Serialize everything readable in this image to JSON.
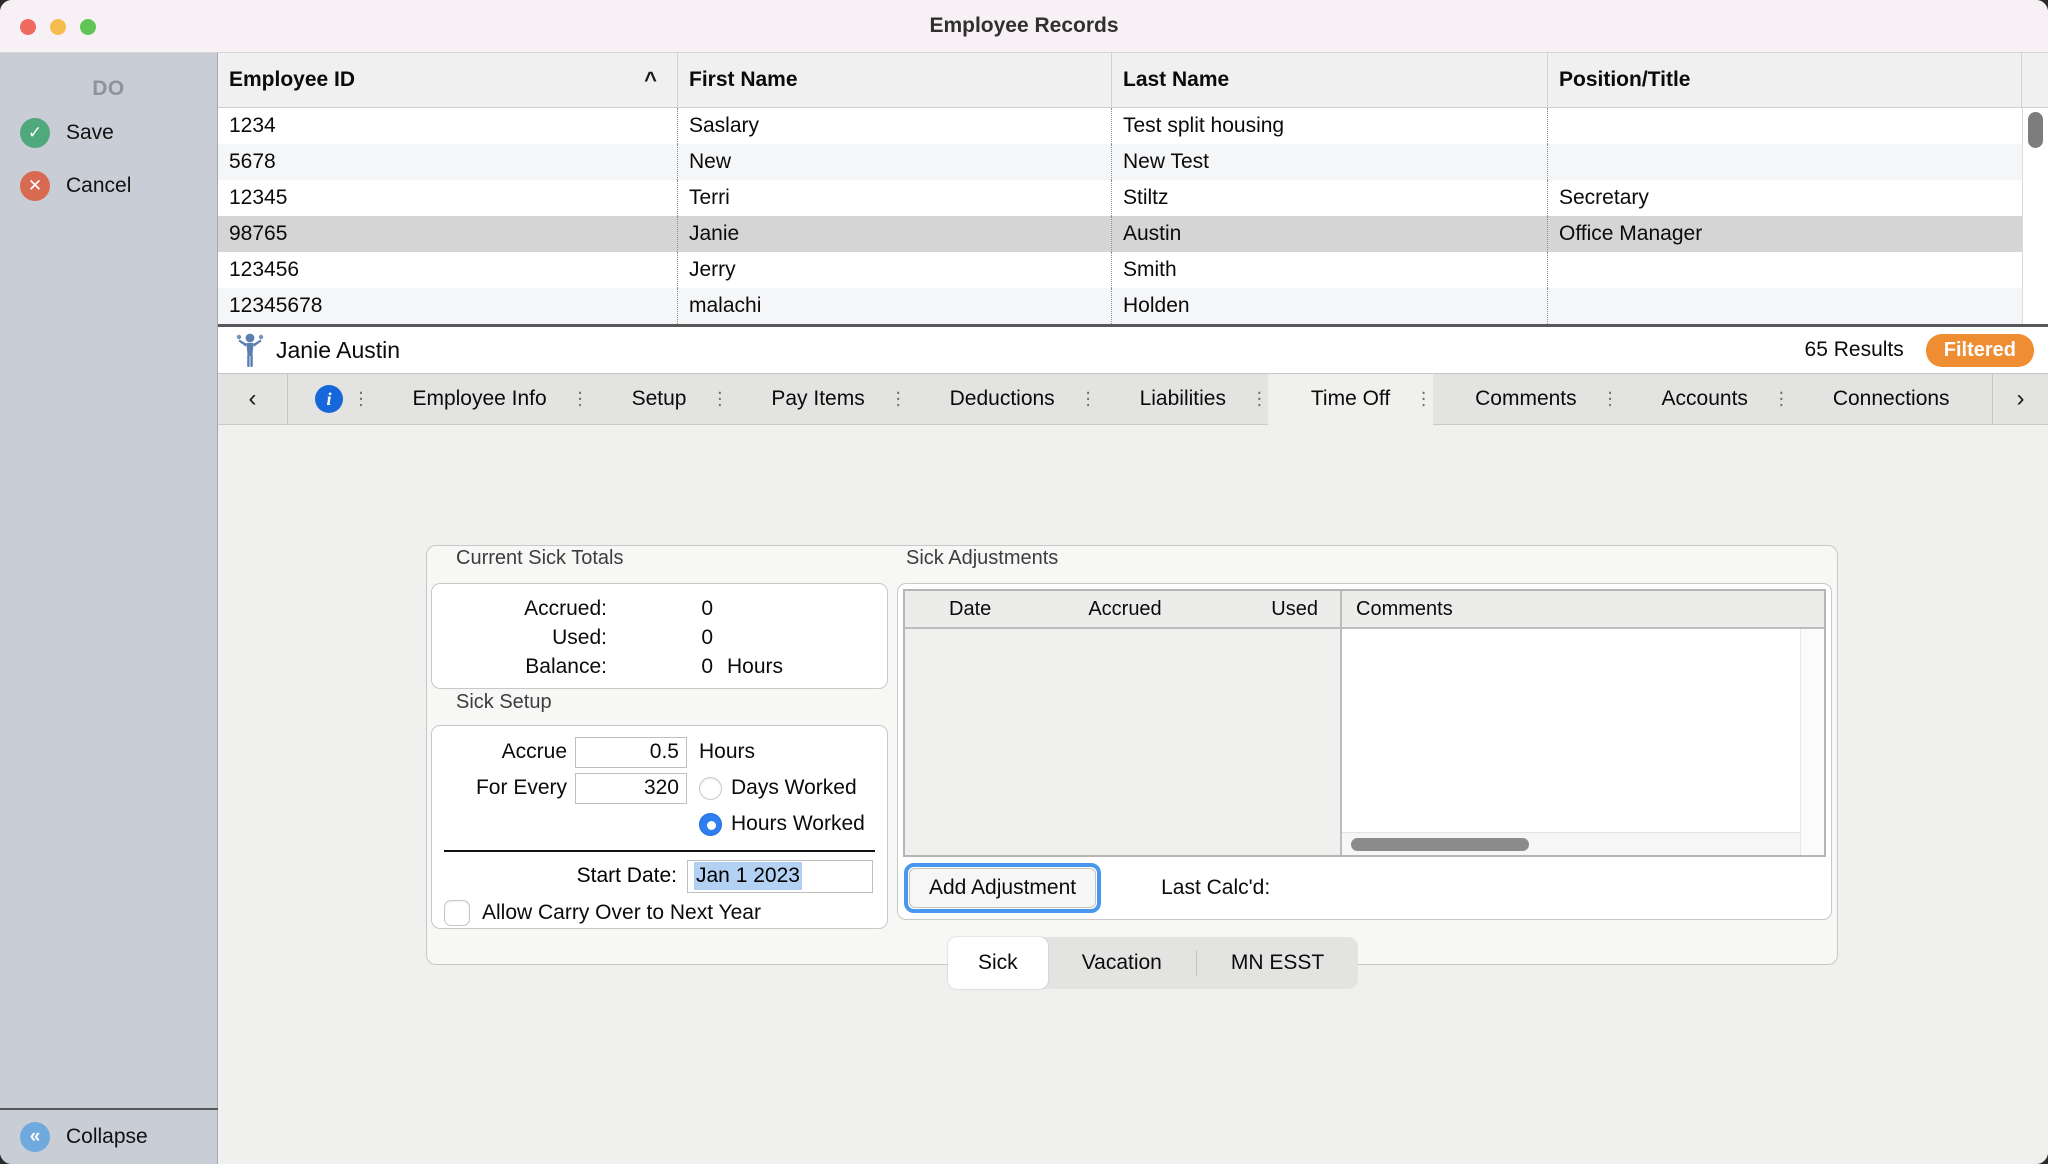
{
  "window": {
    "title": "Employee Records"
  },
  "sidebar": {
    "header": "DO",
    "save_label": "Save",
    "cancel_label": "Cancel",
    "collapse_label": "Collapse",
    "save_icon": "check",
    "cancel_icon": "x",
    "collapse_icon": "double-chevron-left"
  },
  "table": {
    "columns": [
      "Employee ID",
      "First Name",
      "Last Name",
      "Position/Title"
    ],
    "sort_caret": "^",
    "rows": [
      [
        "1234",
        "Saslary",
        "Test split housing",
        ""
      ],
      [
        "5678",
        "New",
        "New Test",
        ""
      ],
      [
        "12345",
        "Terri",
        "Stiltz",
        "Secretary"
      ],
      [
        "98765",
        "Janie",
        "Austin",
        "Office Manager"
      ],
      [
        "123456",
        "Jerry",
        "Smith",
        ""
      ],
      [
        "12345678",
        "malachi",
        "Holden",
        ""
      ]
    ],
    "selected_row_index": 3
  },
  "record_bar": {
    "name": "Janie Austin",
    "results": "65 Results",
    "filter_badge": "Filtered"
  },
  "tabs": {
    "left_chevron": "‹",
    "right_chevron": "›",
    "info_icon": "i",
    "separator": "⋮",
    "items": [
      "Employee Info",
      "Setup",
      "Pay Items",
      "Deductions",
      "Liabilities",
      "Time Off",
      "Comments",
      "Accounts",
      "Connections"
    ],
    "selected": "Time Off"
  },
  "time_off": {
    "totals": {
      "title": "Current Sick Totals",
      "rows": [
        {
          "label": "Accrued:",
          "value": "0",
          "suffix": ""
        },
        {
          "label": "Used:",
          "value": "0",
          "suffix": ""
        },
        {
          "label": "Balance:",
          "value": "0",
          "suffix": "Hours"
        }
      ]
    },
    "setup": {
      "title": "Sick Setup",
      "accrue_label": "Accrue",
      "accrue_value": "0.5",
      "accrue_suffix": "Hours",
      "for_every_label": "For Every",
      "for_every_value": "320",
      "radio_days_label": "Days Worked",
      "radio_hours_label": "Hours Worked",
      "selected_radio": "Hours Worked",
      "start_date_label": "Start Date:",
      "start_date_value": "Jan 1 2023",
      "carry_over_label": "Allow Carry Over to Next Year",
      "carry_over_checked": false
    },
    "adjustments": {
      "title": "Sick Adjustments",
      "columns": [
        "Date",
        "Accrued",
        "Used",
        "Comments"
      ],
      "rows": [],
      "add_button_label": "Add Adjustment",
      "last_calcd_label": "Last Calc'd:"
    },
    "bottom_tabs": {
      "items": [
        "Sick",
        "Vacation",
        "MN ESST"
      ],
      "selected": "Sick"
    }
  },
  "colors": {
    "titlebar": "#f7f1f6",
    "sidebar": "#c9cdd6",
    "save_green": "#4fa97d",
    "cancel_red": "#d96a52",
    "collapse_blue": "#70a9de",
    "filtered_orange": "#ef8d33",
    "focus_ring_blue": "#4a97f0",
    "radio_blue": "#2e7ef0",
    "selection_highlight": "#b3d2f3",
    "selected_row": "#d5d5d5",
    "info_blue": "#1667d9"
  }
}
